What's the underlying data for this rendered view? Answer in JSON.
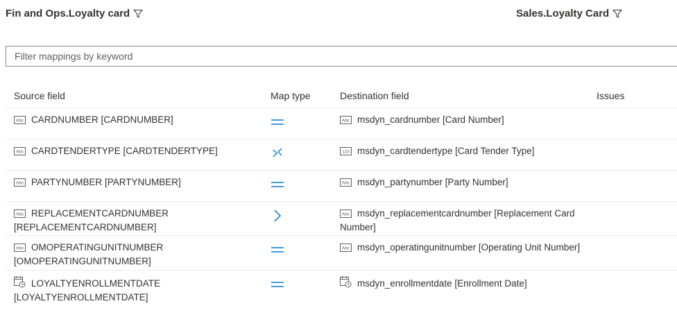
{
  "header": {
    "source_entity": "Fin and Ops.Loyalty card",
    "destination_entity": "Sales.Loyalty Card"
  },
  "filter": {
    "placeholder": "Filter mappings by keyword",
    "value": ""
  },
  "columns": {
    "source": "Source field",
    "map_type": "Map type",
    "destination": "Destination field",
    "issues": "Issues"
  },
  "rows": [
    {
      "source": "CARDNUMBER [CARDNUMBER]",
      "source_icon": "text-field-icon",
      "map_type": "equals-icon",
      "destination": "msdyn_cardnumber [Card Number]",
      "destination_icon": "text-field-icon"
    },
    {
      "source": "CARDTENDERTYPE [CARDTENDERTYPE]",
      "source_icon": "text-field-icon",
      "map_type": "bidirectional-arrows-icon",
      "destination": "msdyn_cardtendertype [Card Tender Type]",
      "destination_icon": "number-field-icon"
    },
    {
      "source": "PARTYNUMBER [PARTYNUMBER]",
      "source_icon": "text-field-icon",
      "map_type": "equals-icon",
      "destination": "msdyn_partynumber [Party Number]",
      "destination_icon": "text-field-icon"
    },
    {
      "source": "REPLACEMENTCARDNUMBER [REPLACEMENTCARDNUMBER]",
      "source_icon": "text-field-icon",
      "map_type": "right-arrow-icon",
      "destination": "msdyn_replacementcardnumber [Replacement Card Number]",
      "destination_icon": "text-field-icon"
    },
    {
      "source": "OMOPERATINGUNITNUMBER [OMOPERATINGUNITNUMBER]",
      "source_icon": "text-field-icon",
      "map_type": "equals-icon",
      "destination": "msdyn_operatingunitnumber [Operating Unit Number]",
      "destination_icon": "text-field-icon"
    },
    {
      "source": "LOYALTYENROLLMENTDATE [LOYALTYENROLLMENTDATE]",
      "source_icon": "date-field-icon",
      "map_type": "equals-icon",
      "destination": "msdyn_enrollmentdate [Enrollment Date]",
      "destination_icon": "date-field-icon"
    }
  ],
  "colors": {
    "accent": "#0078d4",
    "text": "#323130",
    "divider": "#edebe9"
  }
}
